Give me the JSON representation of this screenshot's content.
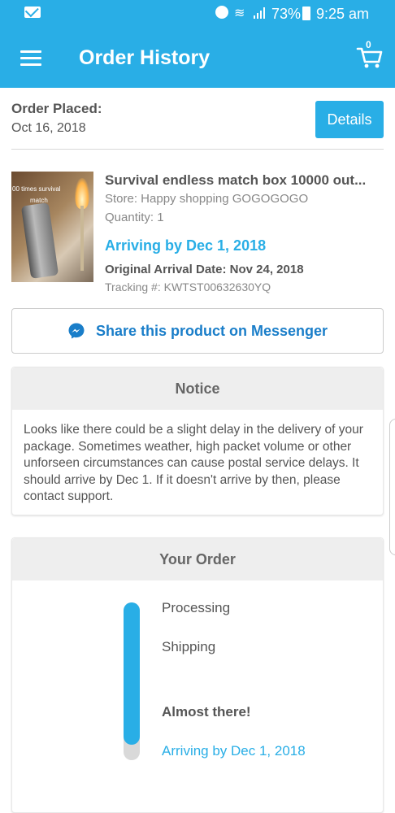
{
  "status_bar": {
    "battery": "73%",
    "time": "9:25 am",
    "icons": [
      "mail-icon",
      "alarm-icon",
      "wifi-icon",
      "signal-icon",
      "battery-icon"
    ]
  },
  "app_bar": {
    "title": "Order History",
    "cart_count": "0",
    "icons": [
      "menu-icon",
      "cart-icon"
    ]
  },
  "order": {
    "placed_label": "Order Placed:",
    "placed_date": "Oct 16, 2018",
    "details_label": "Details",
    "product": {
      "image_caption_line1": "00 times survival",
      "image_caption_line2": "match",
      "title": "Survival endless match box 10000 out...",
      "store": "Store: Happy shopping GOGOGOGO",
      "quantity": "Quantity: 1",
      "arriving": "Arriving by Dec 1, 2018",
      "original_arrival": "Original Arrival Date: Nov 24, 2018",
      "tracking": "Tracking #: KWTST00632630YQ"
    }
  },
  "share": {
    "label": "Share this product on Messenger",
    "icon": "messenger-icon"
  },
  "notice": {
    "title": "Notice",
    "text": "Looks like there could be a slight delay in the delivery of your package. Sometimes weather, high packet volume or other unforseen circumstances can cause postal service delays. It should arrive by Dec 1. If it doesn't arrive by then, please contact support."
  },
  "your_order": {
    "title": "Your Order",
    "progress_fraction": 0.9,
    "stages": [
      "Processing",
      "Shipping",
      "Almost there!",
      "Arriving by Dec 1, 2018"
    ]
  },
  "colors": {
    "accent": "#29aee6",
    "messenger": "#1a7ec9"
  }
}
